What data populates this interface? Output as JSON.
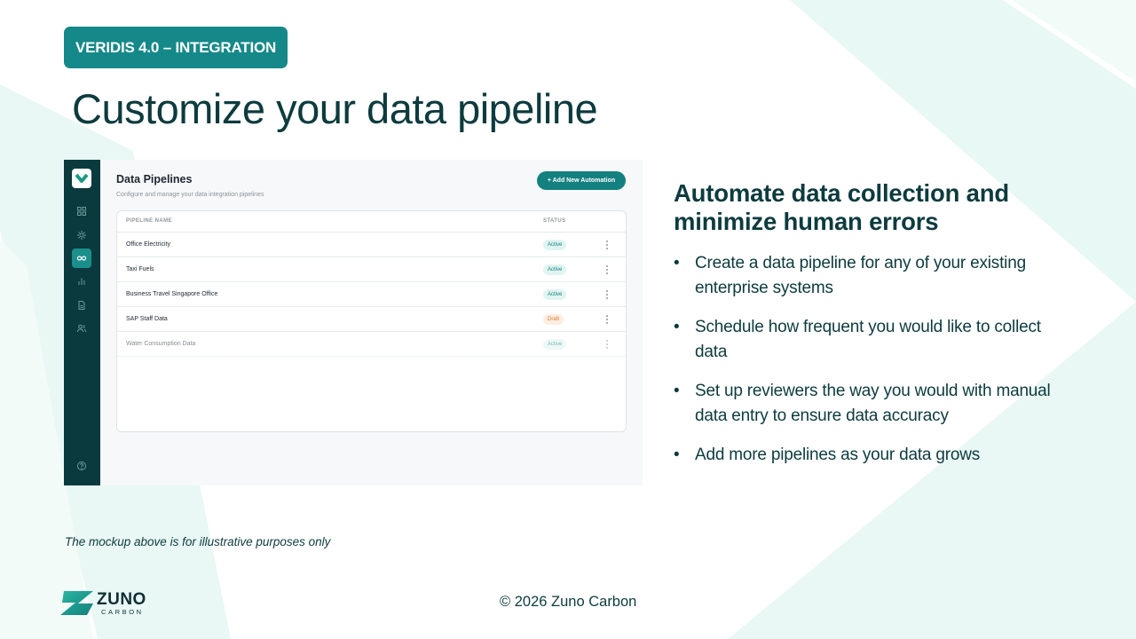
{
  "slide": {
    "badge": "VERIDIS 4.0 – INTEGRATION",
    "title": "Customize your data pipeline",
    "heading": "Automate data collection and minimize human errors",
    "bullets": [
      "Create a data pipeline for any of your existing enterprise systems",
      "Schedule how frequent you would like to collect data",
      "Set up reviewers the way you would with manual data entry to ensure data accuracy",
      "Add more pipelines as your data grows"
    ],
    "disclaimer": "The mockup above is for illustrative purposes only",
    "copyright": "© 2026 Zuno Carbon"
  },
  "brand": {
    "name": "ZUNO",
    "sub": "CARBON"
  },
  "colors": {
    "accent": "#15898a",
    "dark": "#0d3b3e",
    "sidebar": "#0b3a3e",
    "background_stripes": "#e8f8f4"
  },
  "mockup": {
    "title": "Data Pipelines",
    "subtitle": "Configure and manage your data integration pipelines",
    "add_button": "+ Add New Automation",
    "sidebar_icons": [
      "grid-icon",
      "sun-icon",
      "link-icon",
      "bar-chart-icon",
      "document-icon",
      "users-icon",
      "help-icon"
    ],
    "columns": {
      "name": "PIPELINE NAME",
      "status": "STATUS"
    },
    "rows": [
      {
        "name": "Office Electricity",
        "status": "Active"
      },
      {
        "name": "Taxi Fuels",
        "status": "Active"
      },
      {
        "name": "Business Travel Singapore Office",
        "status": "Active"
      },
      {
        "name": "SAP Staff Data",
        "status": "Draft"
      },
      {
        "name": "Water Consumption Data",
        "status": "Active"
      }
    ]
  }
}
